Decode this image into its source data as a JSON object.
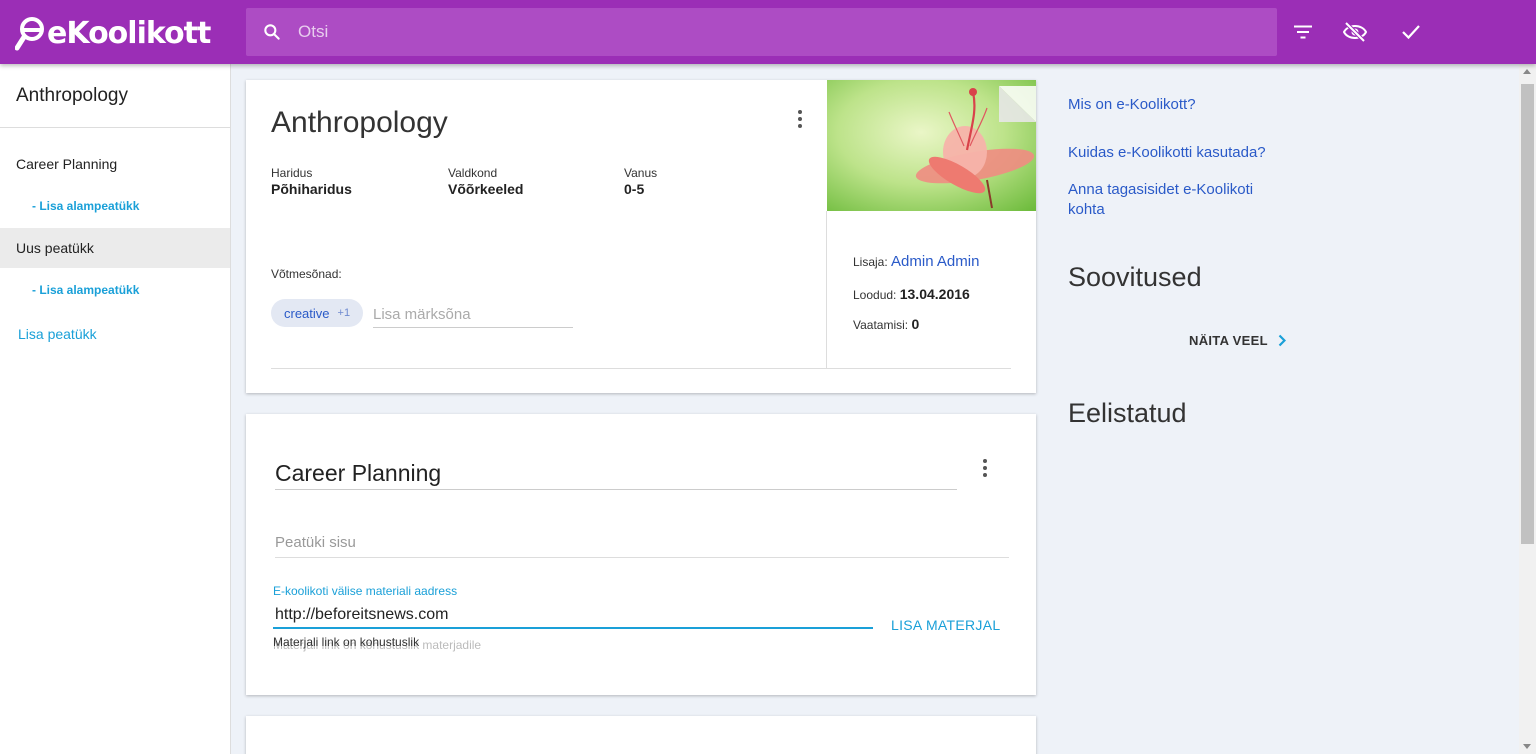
{
  "app": {
    "logo": "eKoolikott"
  },
  "search": {
    "placeholder": "Otsi"
  },
  "toolbar": {
    "filter_icon": "filter-list-icon",
    "hide_icon": "visibility-off-icon",
    "done_icon": "check-icon"
  },
  "colors": {
    "brand": "#9b2eb6",
    "accent": "#1aa0d8",
    "link": "#2a5ac8"
  },
  "sidebar": {
    "title": "Anthropology",
    "items": [
      {
        "label": "Career Planning",
        "sub_label": "- Lisa alampeatükk",
        "active": false
      },
      {
        "label": "Uus peatükk",
        "sub_label": "- Lisa alampeatükk",
        "active": true
      }
    ],
    "add_chapter": "Lisa peatükk"
  },
  "material": {
    "title": "Anthropology",
    "meta": [
      {
        "label": "Haridus",
        "value": "Põhiharidus"
      },
      {
        "label": "Valdkond",
        "value": "Võõrkeeled"
      },
      {
        "label": "Vanus",
        "value": "0-5"
      }
    ],
    "keywords_label": "Võtmesõnad:",
    "keyword_chip": "creative",
    "keyword_more": "+1",
    "keyword_placeholder": "Lisa märksõna",
    "added_by_label": "Lisaja:",
    "added_by": "Admin Admin",
    "created_label": "Loodud:",
    "created": "13.04.2016",
    "views_label": "Vaatamisi:",
    "views": "0"
  },
  "chapter": {
    "title": "Career Planning",
    "content_placeholder": "Peatüki sisu",
    "ext_label": "E-koolikoti välise materiali aadress",
    "ext_value": "http://beforeitsnews.com",
    "ext_hint": "Materjali link on kohustuslik",
    "ext_hint_ghost": "Materjali link on kohustuslik materjadile",
    "add_material": "LISA MATERJAL"
  },
  "right": {
    "links": [
      "Mis on e-Koolikott?",
      "Kuidas e-Koolikotti kasutada?",
      "Anna tagasisidet e-Koolikoti kohta"
    ],
    "recommendations": "Soovitused",
    "show_more": "NÄITA VEEL",
    "featured": "Eelistatud"
  }
}
